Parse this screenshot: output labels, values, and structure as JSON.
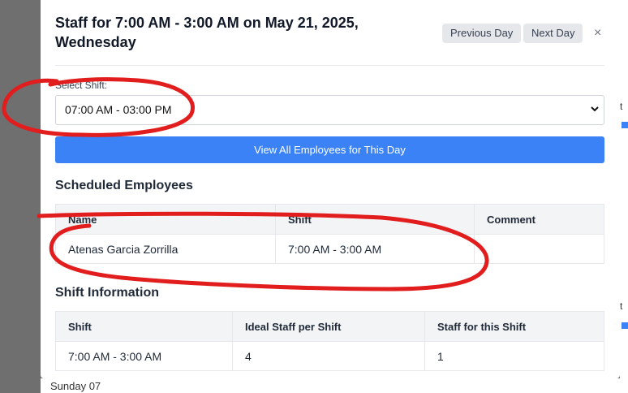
{
  "background": {
    "glyph_top": "t",
    "glyph_bottom": "t",
    "bottom_text": "Sunday 07"
  },
  "modal": {
    "title": "Staff for 7:00 AM - 3:00 AM on May 21, 2025, Wednesday",
    "previous_day_label": "Previous Day",
    "next_day_label": "Next Day",
    "close_label": "×",
    "select_shift_label": "Select Shift:",
    "selected_shift": "07:00 AM - 03:00 PM",
    "view_all_label": "View All Employees for This Day",
    "scheduled": {
      "title": "Scheduled Employees",
      "headers": [
        "Name",
        "Shift",
        "Comment"
      ],
      "rows": [
        [
          "Atenas Garcia Zorrilla",
          "7:00 AM - 3:00 AM",
          ""
        ]
      ]
    },
    "shift_info": {
      "title": "Shift Information",
      "headers": [
        "Shift",
        "Ideal Staff per Shift",
        "Staff for this Shift"
      ],
      "rows": [
        [
          "7:00 AM - 3:00 AM",
          "4",
          "1"
        ]
      ]
    }
  },
  "colors": {
    "primary": "#3b82f6",
    "annotation": "#e11d1d",
    "overlay": "#6f6f6f"
  }
}
